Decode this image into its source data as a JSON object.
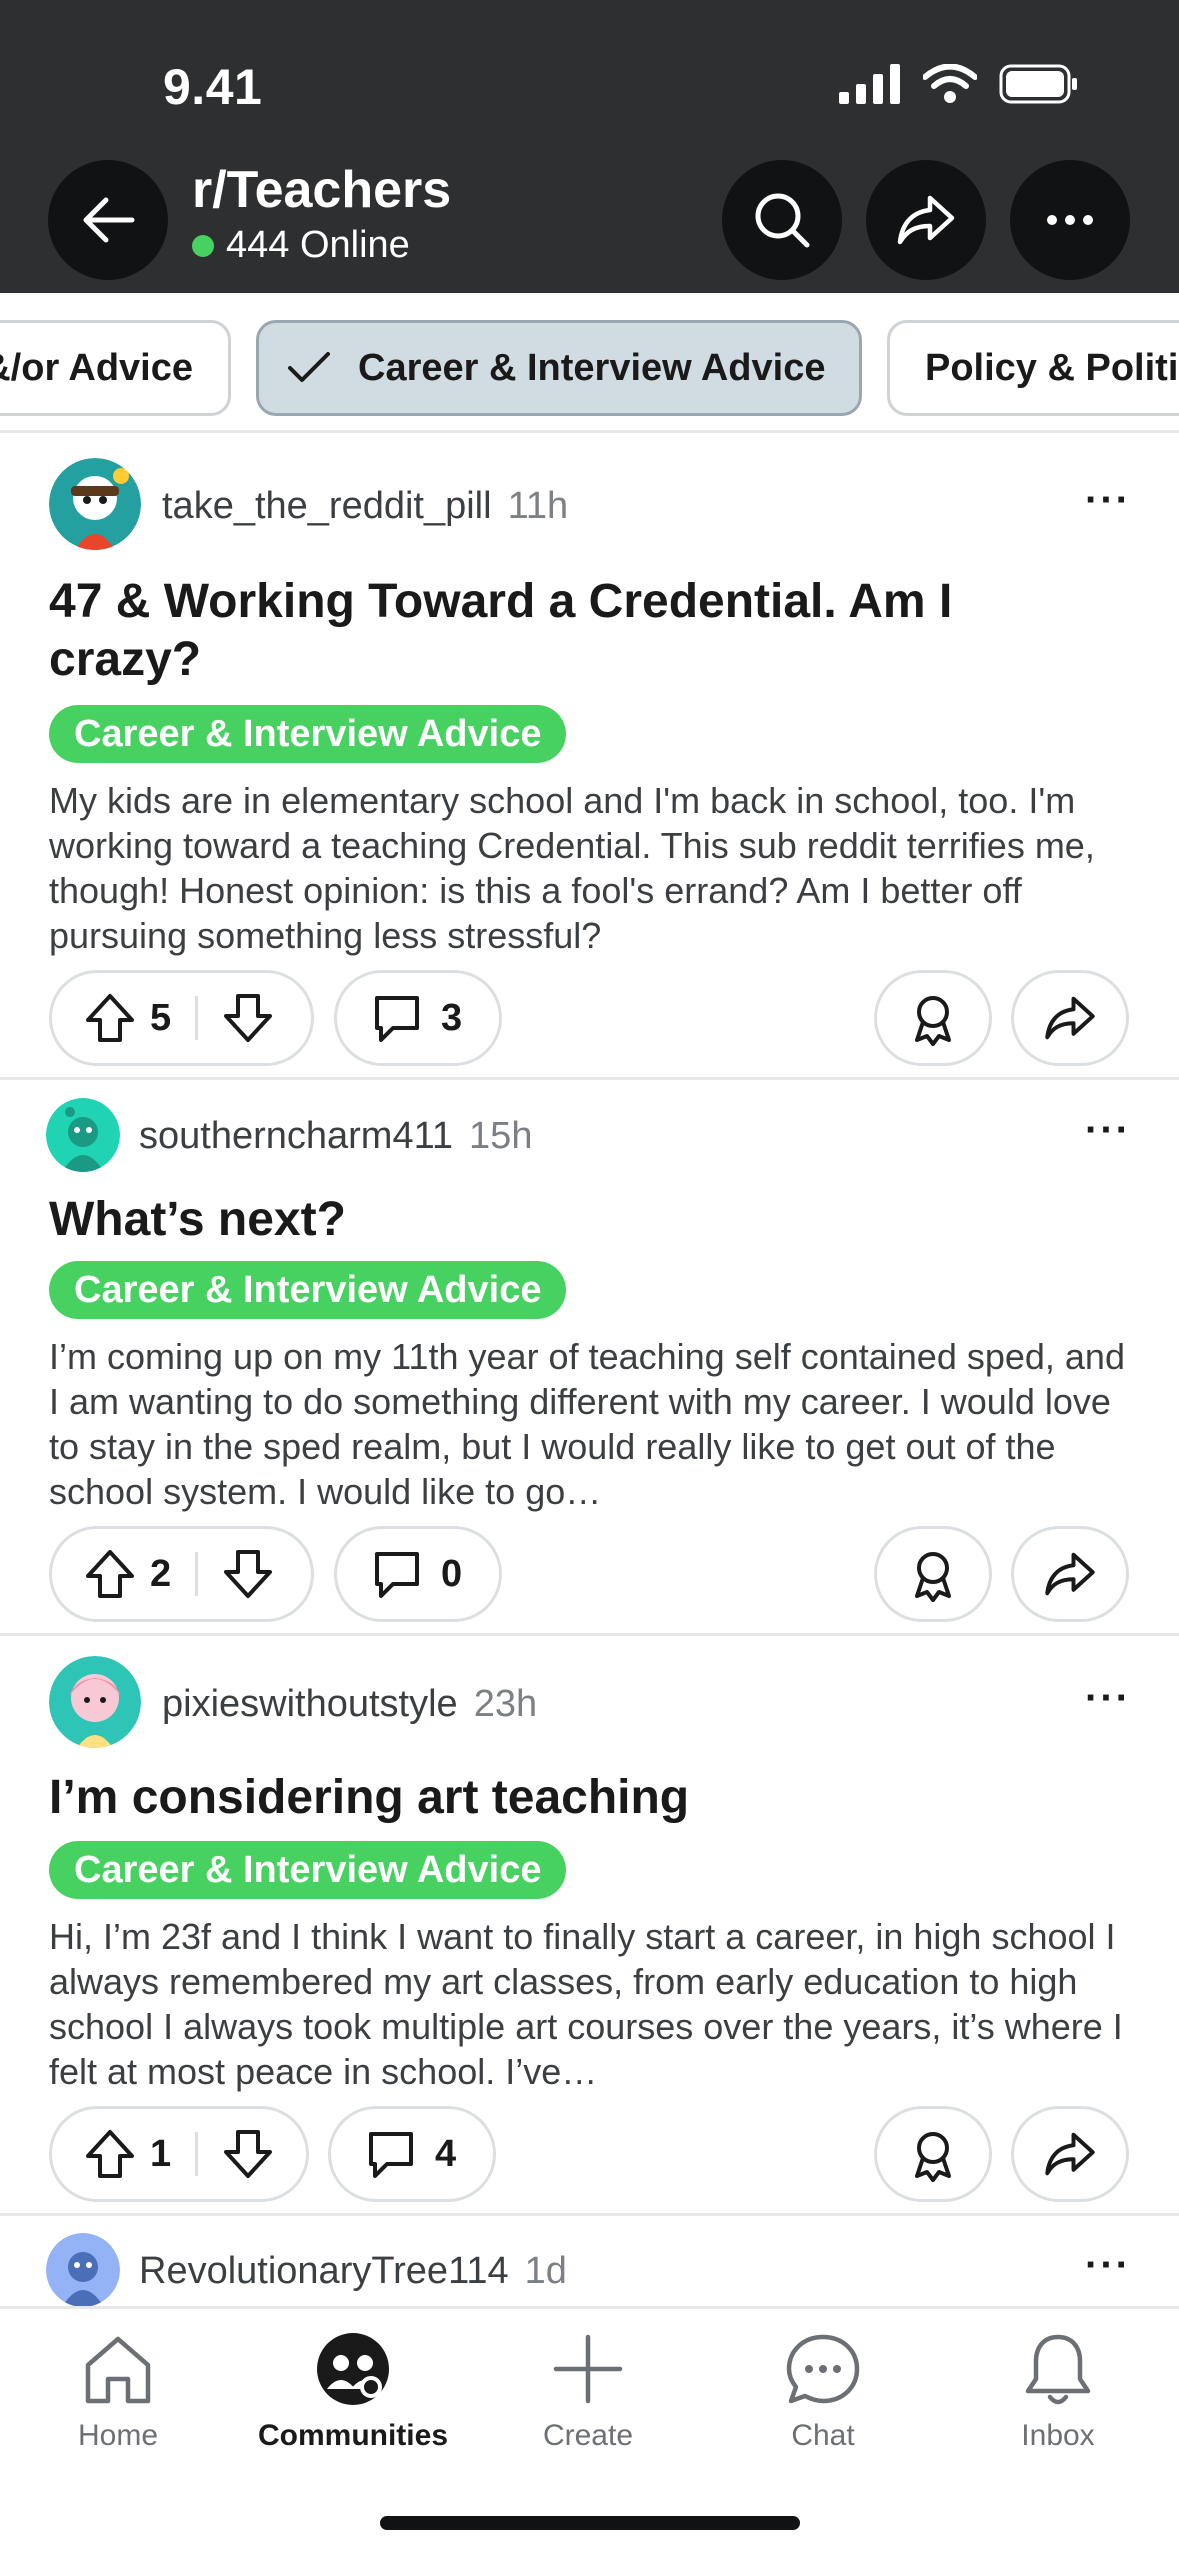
{
  "status_bar": {
    "time": "9.41"
  },
  "header": {
    "subreddit": "r/Teachers",
    "online_count": "444 Online"
  },
  "flair_chips": [
    {
      "label": "&/or Advice",
      "selected": false
    },
    {
      "label": "Career & Interview Advice",
      "selected": true
    },
    {
      "label": "Policy & Politics",
      "selected": false
    }
  ],
  "posts": [
    {
      "author": "take_the_reddit_pill",
      "age": "11h",
      "title": "47 & Working Toward a Credential. Am I crazy?",
      "flair": "Career & Interview Advice",
      "body": "My kids are in elementary school and I'm back in school, too. I'm working toward a teaching Credential. This sub reddit terrifies me, though! Honest opinion: is this a fool's errand? Am I better off pursuing something less stressful?",
      "upvotes": "5",
      "comments": "3"
    },
    {
      "author": "southerncharm411",
      "age": "15h",
      "title": "What’s next?",
      "flair": "Career & Interview Advice",
      "body": "I’m coming up on my 11th year of teaching self contained sped, and I am wanting to do something different with my career. I would love to stay in the sped realm, but I would really like to get out of the school system. I would like to go…",
      "upvotes": "2",
      "comments": "0"
    },
    {
      "author": "pixieswithoutstyle",
      "age": "23h",
      "title": "I’m considering art teaching",
      "flair": "Career & Interview Advice",
      "body": "Hi, I’m 23f and I think I want to finally start a career, in high school I always remembered my art classes, from early education to high school I always took multiple art courses over the years, it’s where I felt at most peace in school. I’ve…",
      "upvotes": "1",
      "comments": "4"
    },
    {
      "author": "RevolutionaryTree114",
      "age": "1d"
    }
  ],
  "bottom_nav": {
    "home": "Home",
    "communities": "Communities",
    "create": "Create",
    "chat": "Chat",
    "inbox": "Inbox"
  },
  "colors": {
    "header_bg": "#2d2f31",
    "flair_green": "#46d160",
    "online_green": "#46d160",
    "selected_chip": "#d0dbe2"
  }
}
